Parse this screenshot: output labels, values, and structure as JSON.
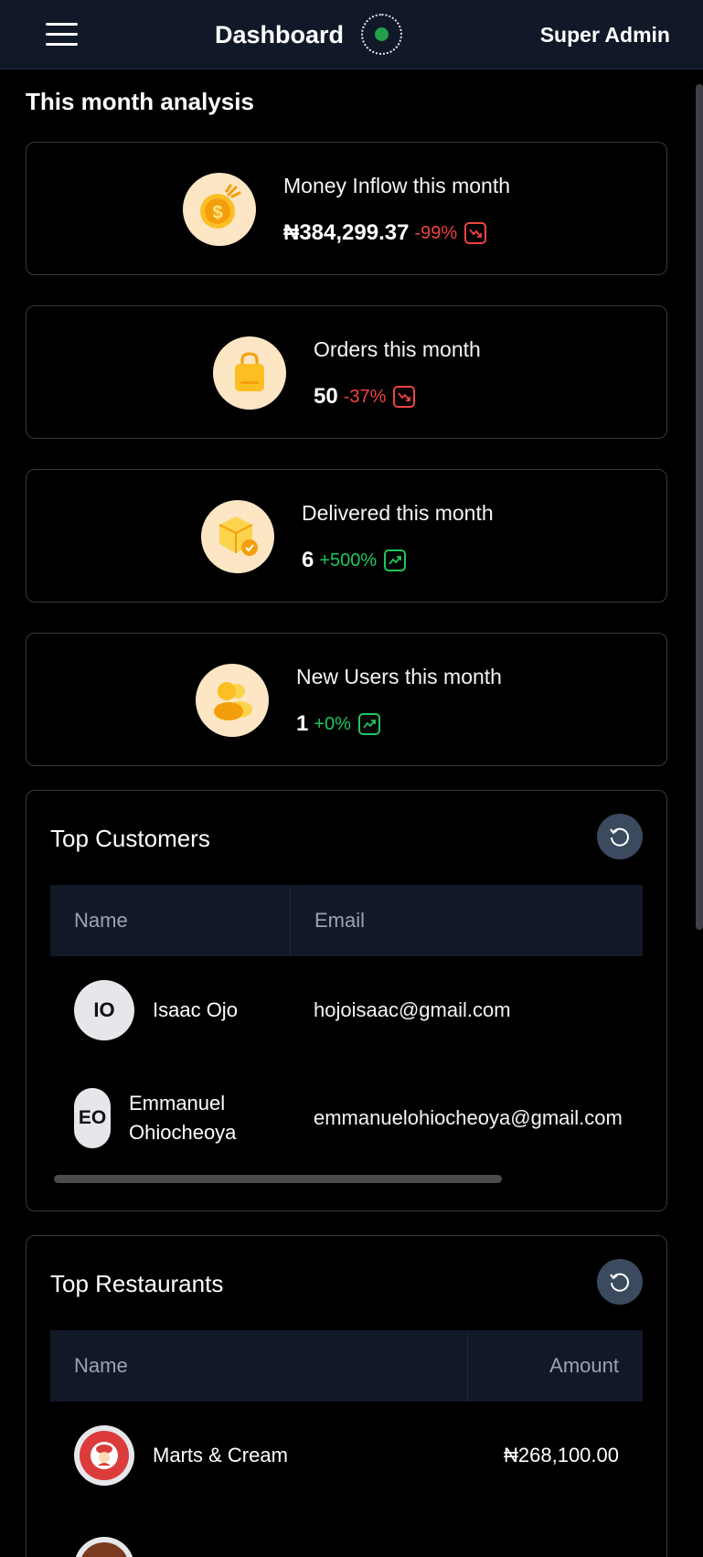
{
  "header": {
    "title": "Dashboard",
    "user": "Super Admin"
  },
  "analysis": {
    "heading": "This month analysis",
    "cards": [
      {
        "label": "Money Inflow this month",
        "value": "₦384,299.37",
        "change": "-99%",
        "trend": "down"
      },
      {
        "label": "Orders this month",
        "value": "50",
        "change": "-37%",
        "trend": "down"
      },
      {
        "label": "Delivered this month",
        "value": "6",
        "change": "+500%",
        "trend": "up"
      },
      {
        "label": "New Users this month",
        "value": "1",
        "change": "+0%",
        "trend": "up"
      }
    ]
  },
  "top_customers": {
    "title": "Top Customers",
    "columns": [
      "Name",
      "Email"
    ],
    "rows": [
      {
        "initials": "IO",
        "name": "Isaac Ojo",
        "email": "hojoisaac@gmail.com"
      },
      {
        "initials": "EO",
        "name_line1": "Emmanuel",
        "name_line2": "Ohiocheoya",
        "email": "emmanuelohiocheoya@gmail.com"
      }
    ]
  },
  "top_restaurants": {
    "title": "Top Restaurants",
    "columns": [
      "Name",
      "Amount"
    ],
    "rows": [
      {
        "name": "Marts & Cream",
        "amount": "₦268,100.00"
      }
    ]
  },
  "icons": {
    "menu": "hamburger-menu-icon",
    "status": "online-status-icon",
    "refresh": "refresh-icon",
    "money": "money-bag-icon",
    "orders": "shopping-bag-icon",
    "delivered": "package-check-icon",
    "users": "users-icon"
  },
  "colors": {
    "accent": "#f59e0b",
    "icon_bg": "#fde6c4",
    "down": "#ef4444",
    "up": "#22c55e",
    "status": "#22a04b"
  }
}
